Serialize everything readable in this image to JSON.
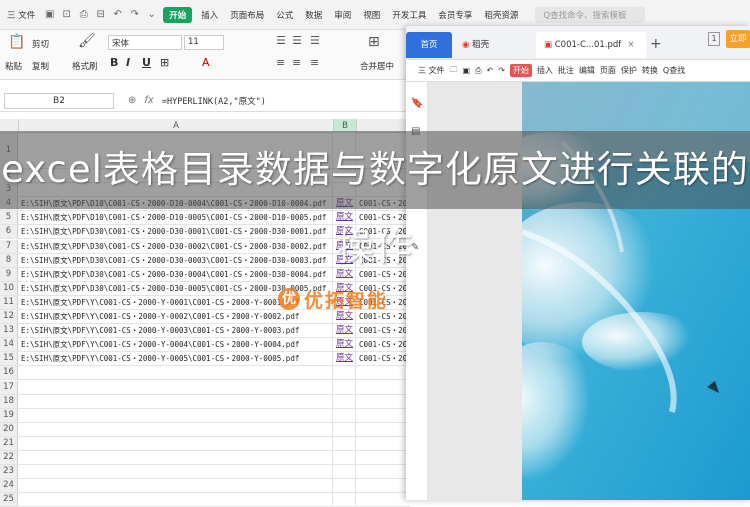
{
  "menubar": {
    "file": "三 文件",
    "tabs": [
      "开始",
      "插入",
      "页面布局",
      "公式",
      "数据",
      "审阅",
      "视图",
      "开发工具",
      "会员专享",
      "稻壳资源"
    ],
    "active_tab": "开始",
    "search_placeholder": "Q查找命令、搜索模板"
  },
  "ribbon": {
    "paste": "粘贴",
    "cut": "剪切",
    "copy": "复制",
    "format_painter": "格式刷",
    "font_name": "宋体",
    "font_size": "11",
    "merge_center": "合并居中"
  },
  "formulabar": {
    "cell_ref": "B2",
    "fx": "fx",
    "formula": "=HYPERLINK(A2,\"原文\")"
  },
  "columns": [
    "A",
    "B"
  ],
  "rows": [
    {
      "n": "1",
      "a": "",
      "b": "",
      "c": ""
    },
    {
      "n": "2",
      "a": "",
      "b": "",
      "c": ""
    },
    {
      "n": "3",
      "a": "",
      "b": "",
      "c": ""
    },
    {
      "n": "4",
      "a": "E:\\SIH\\原文\\PDF\\D10\\C001-CS・2000-D10-0004\\C001-CS・2000-D10-0004.pdf",
      "b": "原文",
      "c": "C001-CS・20"
    },
    {
      "n": "5",
      "a": "E:\\SIH\\原文\\PDF\\D10\\C001-CS・2000-D10-0005\\C001-CS・2000-D10-0005.pdf",
      "b": "原文",
      "c": "C001-CS・20"
    },
    {
      "n": "6",
      "a": "E:\\SIH\\原文\\PDF\\D30\\C001-CS・2000-D30-0001\\C001-CS・2000-D30-0001.pdf",
      "b": "原文",
      "c": "C001-CS・20"
    },
    {
      "n": "7",
      "a": "E:\\SIH\\原文\\PDF\\D30\\C001-CS・2000-D30-0002\\C001-CS・2000-D30-0002.pdf",
      "b": "原文",
      "c": "C001-CS・20"
    },
    {
      "n": "8",
      "a": "E:\\SIH\\原文\\PDF\\D30\\C001-CS・2000-D30-0003\\C001-CS・2000-D30-0003.pdf",
      "b": "原文",
      "c": "C001-CS・20"
    },
    {
      "n": "9",
      "a": "E:\\SIH\\原文\\PDF\\D30\\C001-CS・2000-D30-0004\\C001-CS・2000-D30-0004.pdf",
      "b": "原文",
      "c": "C001-CS・20"
    },
    {
      "n": "10",
      "a": "E:\\SIH\\原文\\PDF\\D30\\C001-CS・2000-D30-0005\\C001-CS・2000-D30-0005.pdf",
      "b": "原文",
      "c": "C001-CS・20"
    },
    {
      "n": "11",
      "a": "E:\\SIH\\原文\\PDF\\Y\\C001-CS・2000-Y-0001\\C001-CS・2000-Y-0001.pdf",
      "b": "原文",
      "c": "C001-CS・20"
    },
    {
      "n": "12",
      "a": "E:\\SIH\\原文\\PDF\\Y\\C001-CS・2000-Y-0002\\C001-CS・2000-Y-0002.pdf",
      "b": "原文",
      "c": "C001-CS・20"
    },
    {
      "n": "13",
      "a": "E:\\SIH\\原文\\PDF\\Y\\C001-CS・2000-Y-0003\\C001-CS・2000-Y-0003.pdf",
      "b": "原文",
      "c": "C001-CS・20"
    },
    {
      "n": "14",
      "a": "E:\\SIH\\原文\\PDF\\Y\\C001-CS・2000-Y-0004\\C001-CS・2000-Y-0004.pdf",
      "b": "原文",
      "c": "C001-CS・20"
    },
    {
      "n": "15",
      "a": "E:\\SIH\\原文\\PDF\\Y\\C001-CS・2000-Y-0005\\C001-CS・2000-Y-0005.pdf",
      "b": "原文",
      "c": "C001-CS・20"
    },
    {
      "n": "16",
      "a": "",
      "b": "",
      "c": ""
    },
    {
      "n": "17",
      "a": "",
      "b": "",
      "c": ""
    },
    {
      "n": "18",
      "a": "",
      "b": "",
      "c": ""
    },
    {
      "n": "19",
      "a": "",
      "b": "",
      "c": ""
    },
    {
      "n": "20",
      "a": "",
      "b": "",
      "c": ""
    },
    {
      "n": "21",
      "a": "",
      "b": "",
      "c": ""
    },
    {
      "n": "22",
      "a": "",
      "b": "",
      "c": ""
    },
    {
      "n": "23",
      "a": "",
      "b": "",
      "c": ""
    },
    {
      "n": "24",
      "a": "",
      "b": "",
      "c": ""
    },
    {
      "n": "25",
      "a": "",
      "b": "",
      "c": ""
    }
  ],
  "pdf": {
    "tab_home": "首页",
    "tab_daoke": "稻壳",
    "tab_file": "C001-C...01.pdf",
    "login": "立即",
    "toolbar_file": "三 文件",
    "toolbar_items": [
      "开始",
      "插入",
      "批注",
      "编辑",
      "页面",
      "保护",
      "转换"
    ],
    "search": "Q查找"
  },
  "overlay": {
    "title": "excel表格目录数据与数字化原文进行关联的操作",
    "watermark": "优拓智能",
    "watermark_logo": "优"
  },
  "colors": {
    "accent_green": "#1aa260",
    "hyperlink_purple": "#7030a0",
    "pdf_blue": "#2f6fde",
    "watermark_orange": "#f07a1a"
  }
}
